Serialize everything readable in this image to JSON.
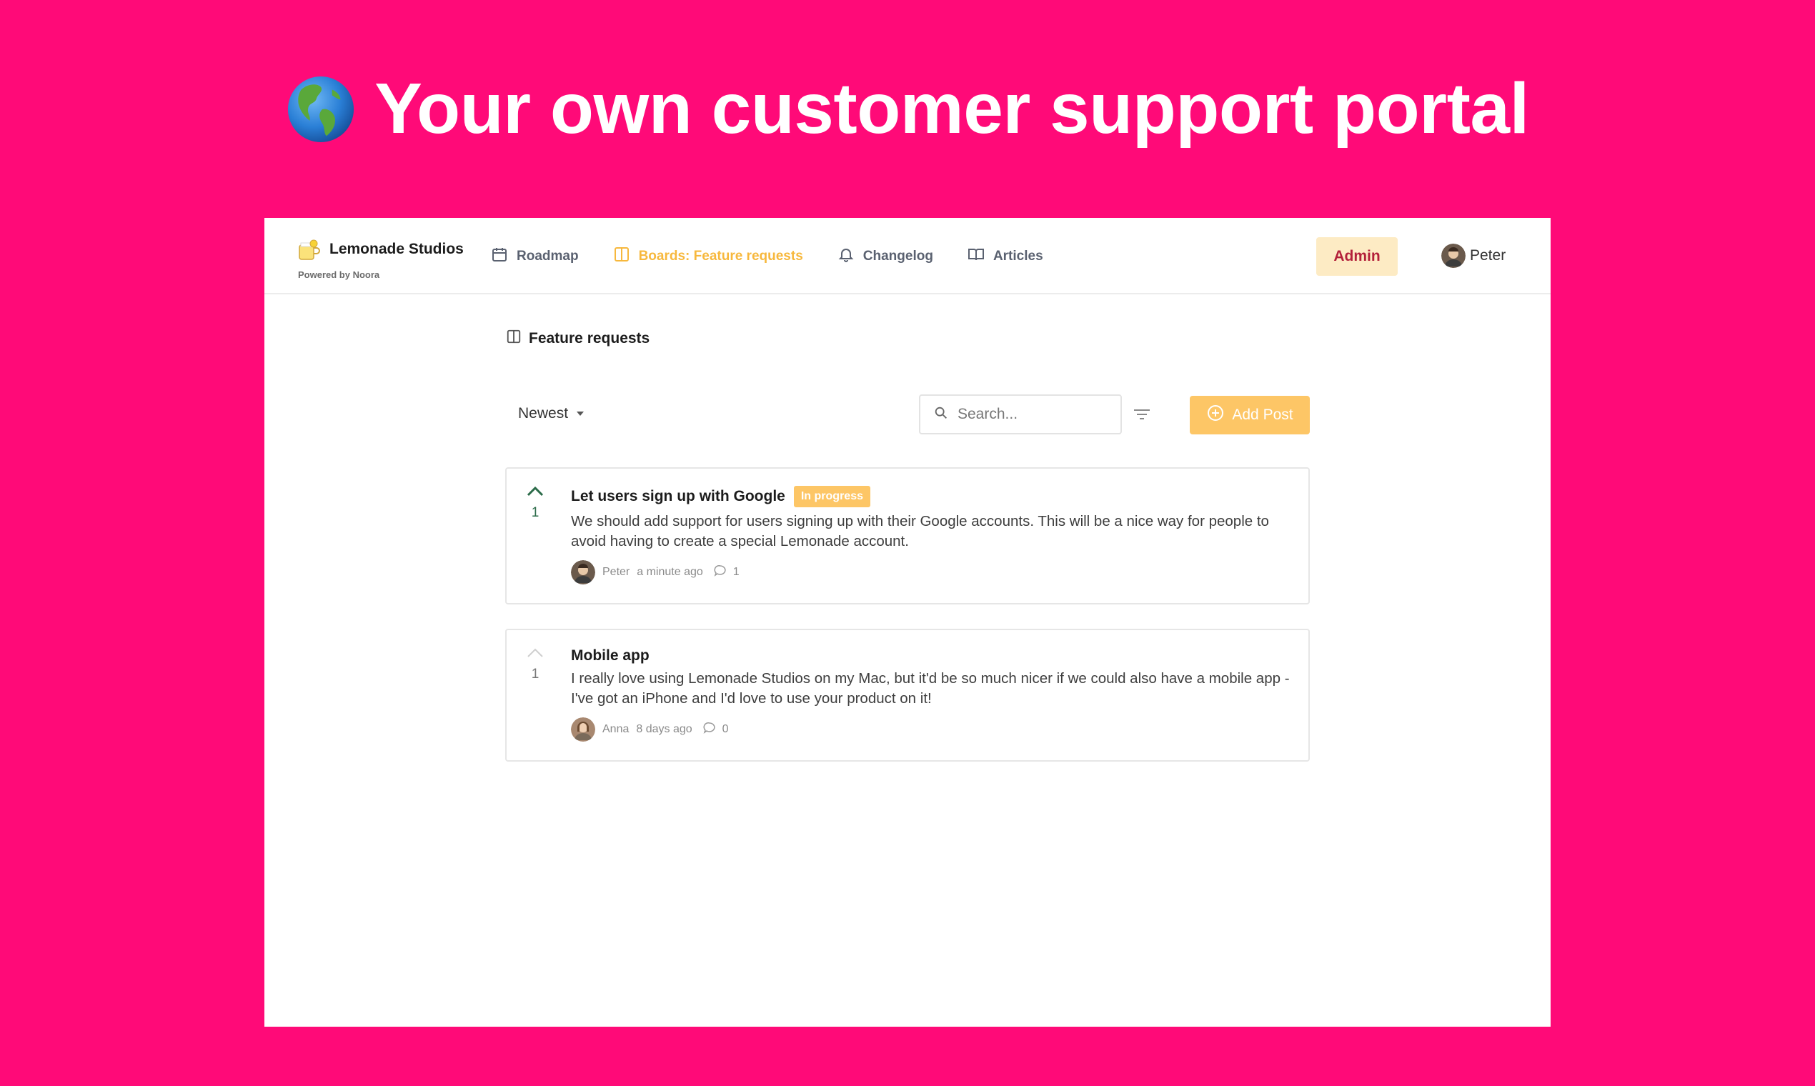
{
  "hero": {
    "emoji": "globe-americas",
    "title": "Your own customer support portal"
  },
  "app": {
    "brand": {
      "name": "Lemonade Studios",
      "powered_by": "Powered by Noora"
    },
    "nav": [
      {
        "label": "Roadmap",
        "icon": "calendar-icon",
        "active": false
      },
      {
        "label": "Boards: Feature requests",
        "icon": "board-icon",
        "active": true
      },
      {
        "label": "Changelog",
        "icon": "bell-icon",
        "active": false
      },
      {
        "label": "Articles",
        "icon": "book-icon",
        "active": false
      }
    ],
    "admin_label": "Admin",
    "user_name": "Peter",
    "colors": {
      "accent": "#f7b83d",
      "button": "#fdc666",
      "admin_bg": "#fdebc4",
      "admin_text": "#b3203a",
      "vote_green": "#2b6b49",
      "background": "#ff0a78"
    }
  },
  "board": {
    "title": "Feature requests",
    "sort_label": "Newest",
    "search_placeholder": "Search...",
    "add_post_label": "Add Post",
    "posts": [
      {
        "title": "Let users sign up with Google",
        "badge": "In progress",
        "description": "We should add support for users signing up with their Google accounts. This will be a nice way for people to avoid having to create a special Lemonade account.",
        "author": "Peter",
        "time": "a minute ago",
        "comments": "1",
        "votes": "1",
        "voted": true
      },
      {
        "title": "Mobile app",
        "badge": "",
        "description": "I really love using Lemonade Studios on my Mac, but it'd be so much nicer if we could also have a mobile app - I've got an iPhone and I'd love to use your product on it!",
        "author": "Anna",
        "time": "8 days ago",
        "comments": "0",
        "votes": "1",
        "voted": false
      }
    ]
  }
}
